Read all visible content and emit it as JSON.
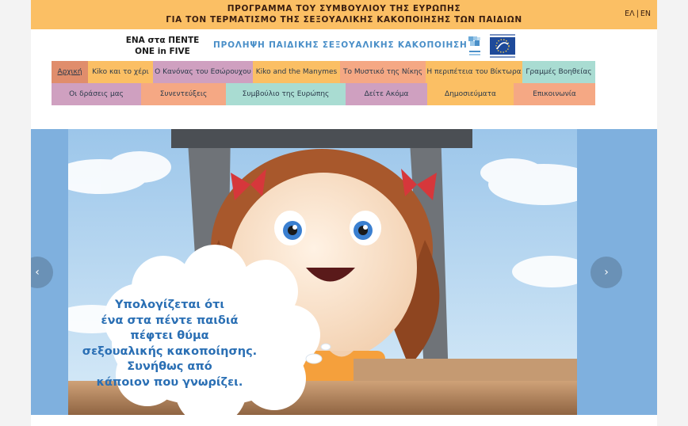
{
  "header": {
    "title_line1": "ΠΡΟΓΡΑΜΜΑ ΤΟΥ ΣΥΜΒΟΥΛΙΟΥ ΤΗΣ ΕΥΡΩΠΗΣ",
    "title_line2": "ΓΙΑ ΤΟΝ ΤΕΡΜΑΤΙΣΜΟ ΤΗΣ ΣΕΞΟΥΑΛΙΚΗΣ ΚΑΚΟΠΟΙΗΣΗΣ ΤΩΝ ΠΑΙΔΙΩΝ",
    "lang_el": "ΕΛ",
    "lang_sep": "|",
    "lang_en": "EN",
    "brand_line1": "ΕΝΑ στα ΠΕΝΤΕ",
    "brand_line2": "ONE in FIVE",
    "tagline": "ΠΡΟΛΗΨΗ ΠΑΙΔΙΚΗΣ ΣΕΞΟΥΑΛΙΚΗΣ ΚΑΚΟΠΟΙΗΣΗΣ"
  },
  "menu": {
    "row1": [
      {
        "label": "Αρχική",
        "color": "#e08d6c"
      },
      {
        "label": "Kiko και το χέρι",
        "color": "#fbbf64"
      },
      {
        "label": "Ο Κανόνας του Εσώρουχου",
        "color": "#cfa0c0"
      },
      {
        "label": "Kiko and the Manymes",
        "color": "#fbbf64"
      },
      {
        "label": "Το Μυστικό της Νίκης",
        "color": "#f5a884"
      },
      {
        "label": "Η περιπέτεια του Βίκτωρα",
        "color": "#fbbf64"
      },
      {
        "label": "Γραμμές Βοηθείας",
        "color": "#a9dcd2"
      }
    ],
    "row2": [
      {
        "label": "Οι δράσεις μας",
        "color": "#cfa0c0"
      },
      {
        "label": "Συνεντεύξεις",
        "color": "#f5a884"
      },
      {
        "label": "Συμβούλιο της Ευρώπης",
        "color": "#a9dcd2"
      },
      {
        "label": "Δείτε Ακόμα",
        "color": "#cfa0c0"
      },
      {
        "label": "Δημοσιεύματα",
        "color": "#fbbf64"
      },
      {
        "label": "Επικοινωνία",
        "color": "#f5a884"
      }
    ]
  },
  "slider": {
    "caption_lines": [
      "Υπολογίζεται ότι",
      "ένα στα πέντε παιδιά",
      "πέφτει θύμα",
      "σεξουαλικής κακοποίησης.",
      "Συνήθως από",
      "κάποιον που γνωρίζει."
    ],
    "prev_icon": "chevron-left-icon",
    "next_icon": "chevron-right-icon",
    "prev_glyph": "‹",
    "next_glyph": "›"
  },
  "colors": {
    "topbar": "#fbbf64",
    "accent_blue": "#4a8fc8",
    "slider_side": "#7fb0de"
  }
}
